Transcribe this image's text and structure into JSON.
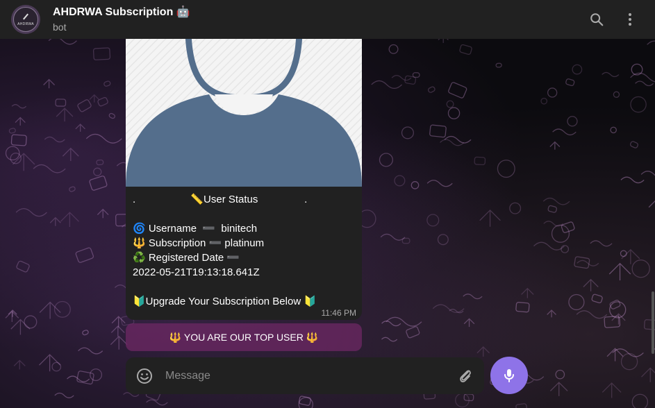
{
  "header": {
    "title": "AHDRWA Subscription 🤖",
    "subtitle": "bot",
    "avatar_text": "AHDRWA",
    "search_icon": "search-icon",
    "menu_icon": "more-vertical-icon"
  },
  "message": {
    "lines": [
      ".                   📏User Status                .",
      "",
      "🌀 Username  ➖  binitech",
      "🔱 Subscription ➖ platinum",
      "♻️ Registered Date ➖",
      "2022-05-21T19:13:18.641Z",
      "",
      "🔰Upgrade Your Subscription Below 🔰"
    ],
    "time": "11:46 PM"
  },
  "keyboard_button": {
    "label": "🔱 YOU ARE OUR TOP USER 🔱"
  },
  "composer": {
    "placeholder": "Message"
  },
  "colors": {
    "accent": "#8e73e8",
    "bubble": "#212121",
    "header": "#212121",
    "avatar_silhouette": "#546e8c"
  }
}
